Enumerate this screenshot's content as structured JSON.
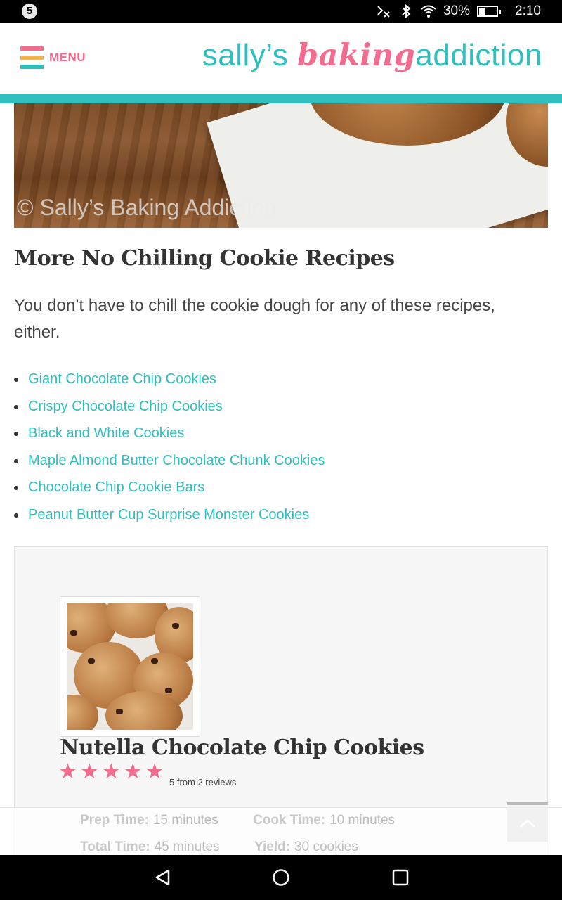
{
  "status_bar": {
    "notification_count": "5",
    "battery_percent": "30%",
    "battery_level": 0.3,
    "time": "2:10",
    "icons": [
      "no-mobile-data-icon",
      "bluetooth-icon",
      "wifi-icon",
      "battery-icon"
    ]
  },
  "header": {
    "menu_label": "MENU",
    "logo": {
      "part1": "sally’s ",
      "part2": "baking",
      "part3": "addiction"
    },
    "hamburger_colors": [
      "#f36c8d",
      "#f6b54b",
      "#2fbfbf"
    ],
    "accent_color": "#2fbfbf",
    "pink_color": "#f36c8d"
  },
  "hero": {
    "watermark": "© Sally’s Baking Addiction"
  },
  "article": {
    "section_title": "More No Chilling Cookie Recipes",
    "intro": "You don’t have to chill the cookie dough for any of these recipes, either.",
    "links": [
      "Giant Chocolate Chip Cookies",
      "Crispy Chocolate Chip Cookies",
      "Black and White Cookies",
      "Maple Almond Butter Chocolate Chunk Cookies",
      "Chocolate Chip Cookie Bars",
      "Peanut Butter Cup Surprise Monster Cookies"
    ]
  },
  "recipe_card": {
    "title": "Nutella Chocolate Chip Cookies",
    "stars": 5,
    "rating_text": "5 from 2 reviews",
    "details": {
      "prep_label": "Prep Time:",
      "prep_value": "15 minutes",
      "cook_label": "Cook Time:",
      "cook_value": "10 minutes",
      "total_label": "Total Time:",
      "total_value": "45 minutes",
      "yield_label": "Yield:",
      "yield_value": "30 cookies"
    }
  },
  "nav_bar": {
    "buttons": [
      "back-icon",
      "home-icon",
      "recents-icon"
    ]
  }
}
